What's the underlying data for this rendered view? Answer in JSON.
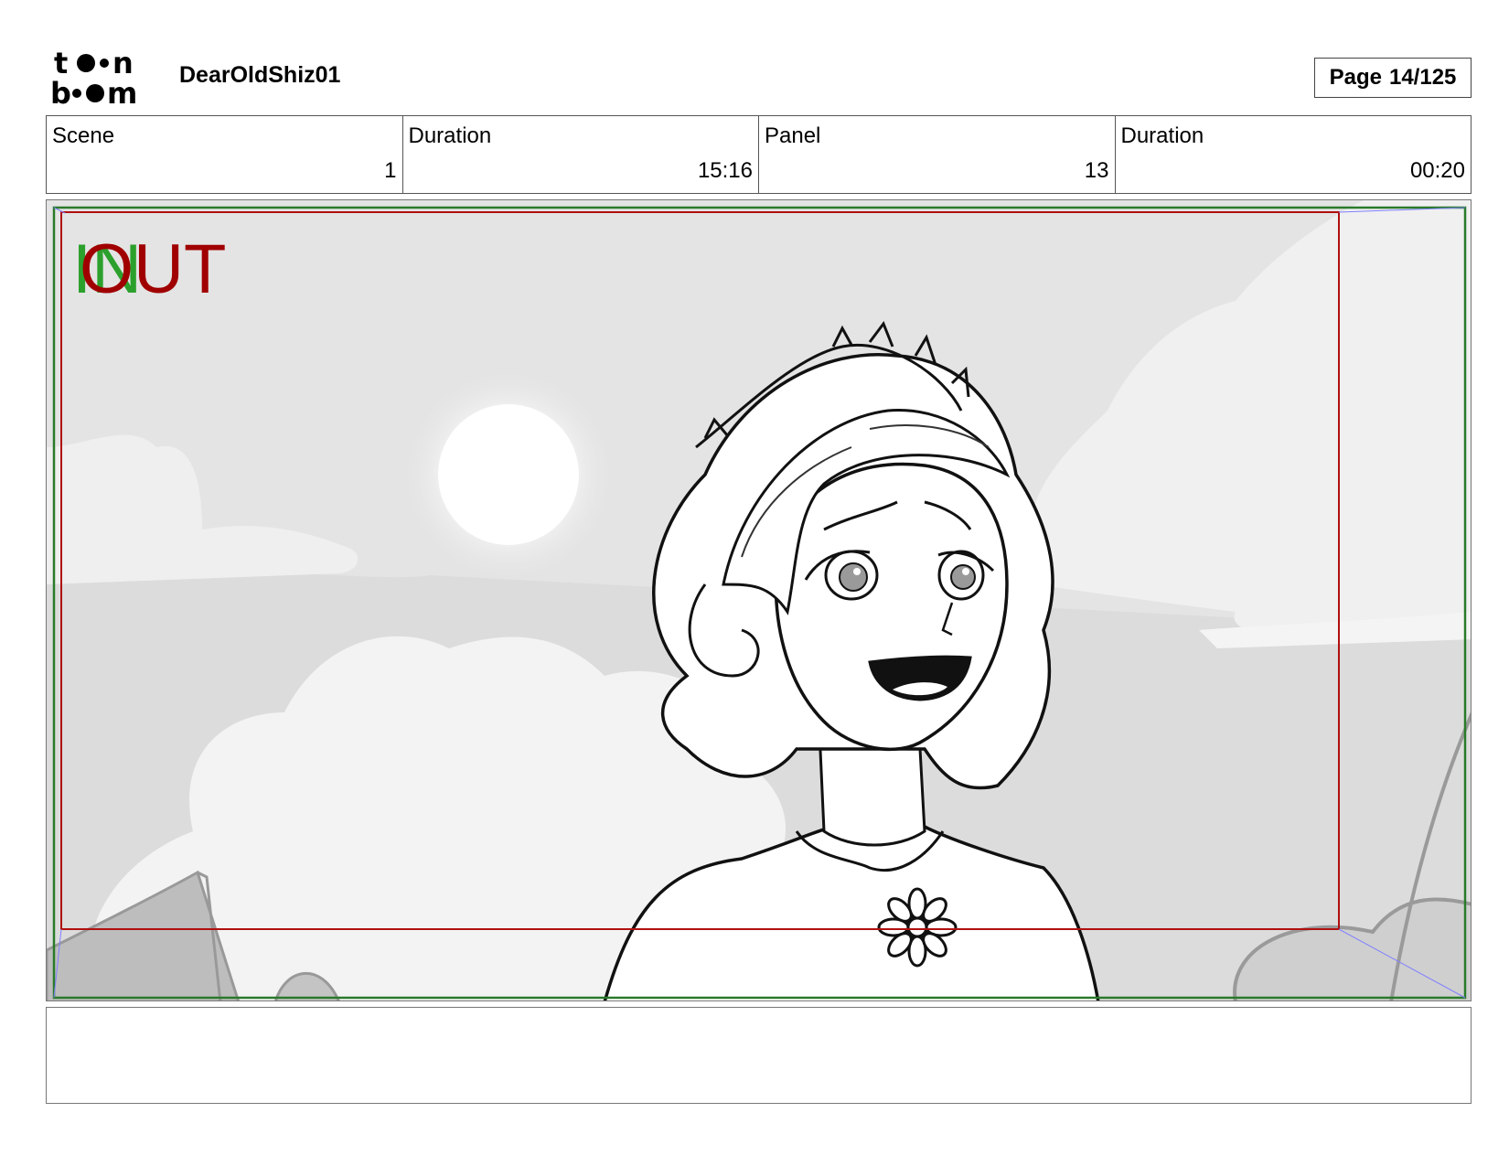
{
  "header": {
    "logo_text": "toon boom",
    "project_title": "DearOldShiz01",
    "page_label": "Page",
    "page_number": "14/125"
  },
  "info": [
    {
      "label": "Scene",
      "value": "1"
    },
    {
      "label": "Duration",
      "value": "15:16"
    },
    {
      "label": "Panel",
      "value": "13"
    },
    {
      "label": "Duration",
      "value": "00:20"
    }
  ],
  "panel": {
    "in_label": "IN",
    "out_label": "OUT",
    "in_color": "#2ca02c",
    "out_color": "#a00000"
  },
  "notes": ""
}
